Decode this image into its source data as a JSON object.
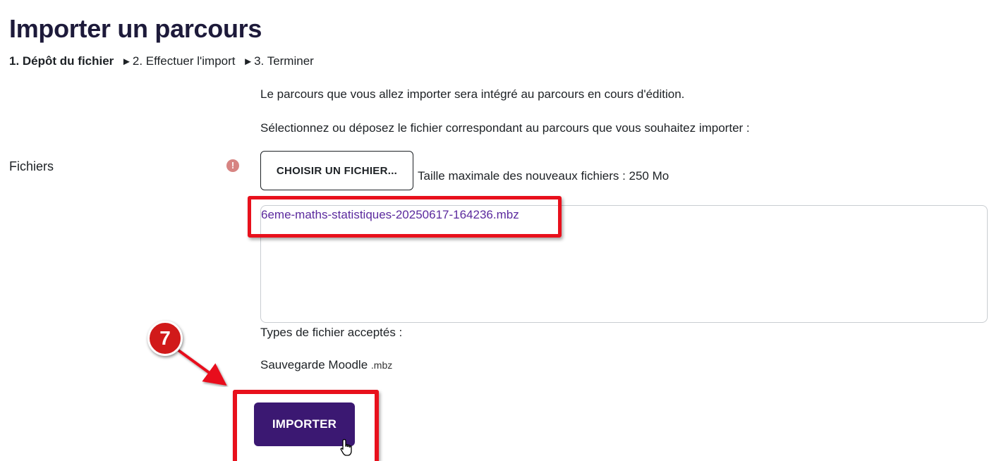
{
  "page": {
    "title": "Importer un parcours"
  },
  "steps": {
    "step1": "1. Dépôt du fichier",
    "separator": "►",
    "step2": "2. Effectuer l'import",
    "step3": "3. Terminer"
  },
  "intro": {
    "line1": "Le parcours que vous allez importer sera intégré au parcours en cours d'édition.",
    "line2": "Sélectionnez ou déposez le fichier correspondant au parcours que vous souhaitez importer :"
  },
  "files_field": {
    "label": "Fichiers",
    "required_icon": "!",
    "choose_button_label": "CHOISIR UN FICHIER...",
    "max_size_text": "Taille maximale des nouveaux fichiers : 250 Mo",
    "uploaded_file": "6eme-maths-statistiques-20250617-164236.mbz",
    "accepted_types_label": "Types de fichier acceptés :",
    "accepted_type_name": "Sauvegarde Moodle",
    "accepted_type_ext": ".mbz"
  },
  "actions": {
    "import_button_label": "IMPORTER"
  },
  "annotation": {
    "step_number": "7",
    "highlight_color": "#e8101c",
    "badge_color": "#d11a1a"
  },
  "colors": {
    "primary_button": "#3b1872",
    "link": "#5b2a9e",
    "required_icon": "#d78482"
  }
}
